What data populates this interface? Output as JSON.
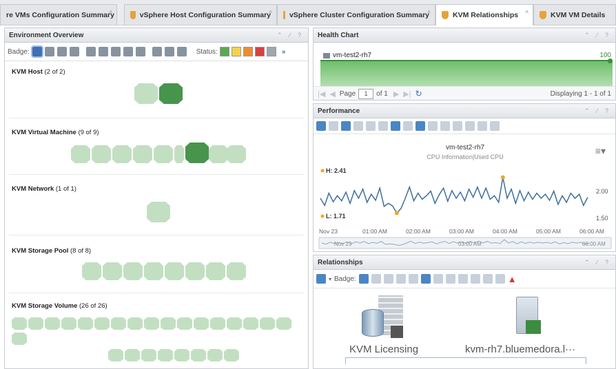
{
  "tabs": [
    {
      "label": "re VMs Configuration Summary"
    },
    {
      "label": "vSphere Host Configuration Summary"
    },
    {
      "label": "vSphere Cluster Configuration Summary"
    },
    {
      "label": "KVM Relationships",
      "active": true
    },
    {
      "label": "KVM VM Details"
    }
  ],
  "env": {
    "title": "Environment Overview",
    "controls": "⌃ ⁄ ?",
    "badge_label": "Badge:",
    "status_label": "Status:",
    "more": "»",
    "groups": [
      {
        "name": "KVM Host",
        "count": "(2 of 2)"
      },
      {
        "name": "KVM Virtual Machine",
        "count": "(9 of 9)"
      },
      {
        "name": "KVM Network",
        "count": "(1 of 1)"
      },
      {
        "name": "KVM Storage Pool",
        "count": "(8 of 8)"
      },
      {
        "name": "KVM Storage Volume",
        "count": "(26 of 26)"
      }
    ]
  },
  "health": {
    "title": "Health Chart",
    "controls": "⌃ ⁄ ?",
    "vm_name": "vm-test2-rh7",
    "value": "100",
    "page_label": "Page",
    "page_value": "1",
    "of_label": "of 1",
    "displaying": "Displaying 1 - 1 of 1"
  },
  "performance": {
    "title": "Performance",
    "controls": "⌃ ⁄ ?",
    "chart_title": "vm-test2-rh7",
    "chart_subtitle": "CPU Information|Used CPU",
    "high_label": "H: 2.41",
    "low_label": "L: 1.71",
    "x_ticks": [
      "Nov 23",
      "01:00 AM",
      "02:00 AM",
      "03:00 AM",
      "04:00 AM",
      "05:00 AM",
      "06:00 AM"
    ],
    "y_ticks": [
      "2.00",
      "1.50"
    ],
    "nav_start": "Nov 23",
    "nav_mid": "03:00 AM",
    "nav_end": "06:00 AM",
    "line_color": "#3e6f9e",
    "marker_color": "#f2a623"
  },
  "relationships": {
    "title": "Relationships",
    "controls": "⌃ ⁄ ?",
    "badge_label": "Badge:",
    "node1": "KVM Licensing",
    "node2": "kvm-rh7.bluemedora.l···"
  },
  "chart_data": {
    "type": "line",
    "title": "vm-test2-rh7",
    "subtitle": "CPU Information|Used CPU",
    "x_range": [
      "Nov 23 00:00",
      "Nov 23 06:00"
    ],
    "y_range": [
      1.5,
      2.5
    ],
    "series": [
      {
        "values": [
          2.0,
          1.86,
          2.1,
          1.93,
          2.05,
          1.95,
          2.12,
          1.9,
          2.15,
          2.0,
          2.18,
          1.92,
          2.08,
          1.96,
          2.2,
          1.84,
          1.9,
          1.85,
          1.71,
          1.8,
          2.0,
          2.22,
          1.95,
          2.1,
          1.98,
          2.05,
          2.14,
          1.9,
          2.07,
          2.2,
          1.94,
          2.15,
          2.0,
          2.12,
          1.95,
          2.18,
          2.02,
          2.22,
          2.0,
          2.2,
          1.98,
          2.05,
          1.92,
          2.41,
          2.0,
          2.18,
          1.9,
          2.15,
          1.95,
          2.12,
          1.98,
          2.1,
          2.0,
          2.08,
          1.96,
          2.14,
          1.88,
          2.05,
          1.92,
          2.1,
          2.0,
          2.08,
          1.86,
          2.02
        ]
      }
    ],
    "high": 2.41,
    "low": 1.71
  }
}
